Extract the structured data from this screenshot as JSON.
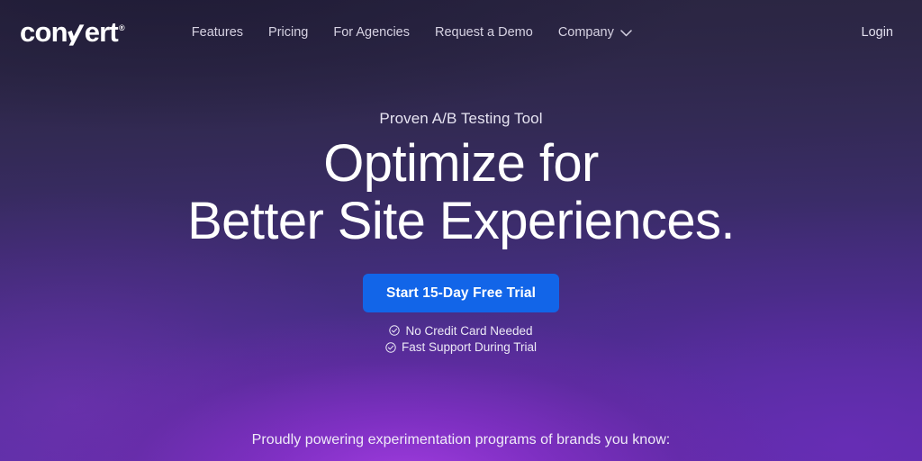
{
  "site": {
    "logo": {
      "text_before": "con",
      "mark": "v-slash-mark",
      "text_after": "ert",
      "registered": "®"
    },
    "nav": [
      {
        "label": "Features",
        "icon": null
      },
      {
        "label": "Pricing",
        "icon": null
      },
      {
        "label": "For Agencies",
        "icon": null
      },
      {
        "label": "Request a Demo",
        "icon": null
      },
      {
        "label": "Company",
        "icon": "chevron-down-icon"
      }
    ],
    "login_label": "Login"
  },
  "hero": {
    "eyebrow": "Proven A/B Testing Tool",
    "headline_line1": "Optimize for",
    "headline_line2": "Better Site Experiences.",
    "cta_label": "Start 15-Day Free Trial",
    "perks": [
      {
        "icon": "check-circle-icon",
        "label": "No Credit Card Needed"
      },
      {
        "icon": "check-circle-icon",
        "label": "Fast Support During Trial"
      }
    ]
  },
  "brands": {
    "caption": "Proudly powering experimentation programs of brands you know:"
  },
  "colors": {
    "cta_blue": "#1265e8",
    "background_top": "#2a2540",
    "background_bottom": "#5f2fae",
    "glow_purple": "#a23ce0",
    "text_primary": "#ffffff",
    "text_muted": "#d6d2e2"
  }
}
